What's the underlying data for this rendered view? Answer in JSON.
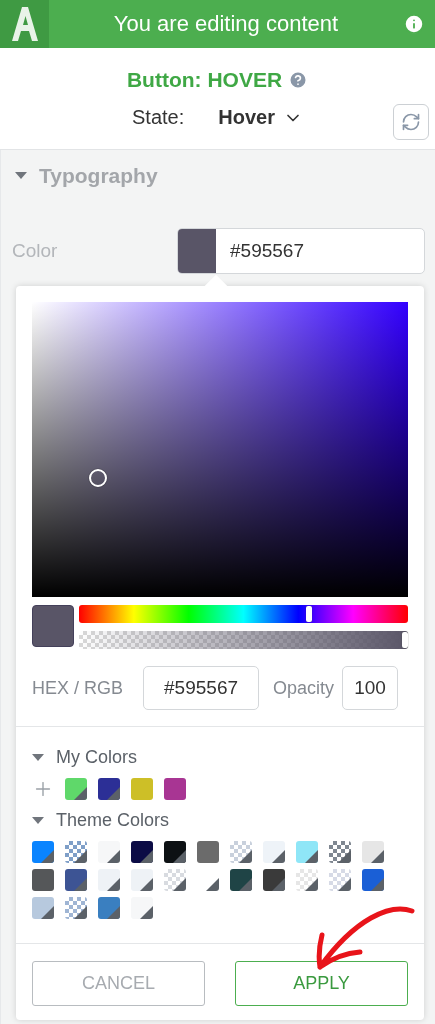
{
  "header": {
    "title": "You are editing content"
  },
  "panel_title": "Button: HOVER",
  "state": {
    "label": "State:",
    "value": "Hover"
  },
  "section": {
    "title": "Typography",
    "expanded": true
  },
  "color_field": {
    "label": "Color",
    "value": "#595567"
  },
  "picker": {
    "hue": {
      "level": 0.7
    },
    "alpha": {
      "level": 1
    },
    "hex_label": "HEX / RGB",
    "hex_value": "#595567",
    "opacity_label": "Opacity",
    "opacity_value": "100",
    "my_colors": {
      "title": "My Colors",
      "expanded": true,
      "swatches": [
        {
          "color": "#5fd86a",
          "kind": "solid",
          "corner": true
        },
        {
          "color": "#2c2f96",
          "kind": "solid",
          "corner": true
        },
        {
          "color": "#cdbf27",
          "kind": "solid",
          "corner": false
        },
        {
          "color": "#a83593",
          "kind": "solid",
          "corner": false
        }
      ]
    },
    "theme_colors": {
      "title": "Theme Colors",
      "expanded": true,
      "swatches": [
        {
          "color": "#0a84ff",
          "kind": "solid",
          "corner": true
        },
        {
          "color": "#7f9fc8",
          "kind": "checker",
          "corner": true
        },
        {
          "color": "#f6f7f8",
          "kind": "solid",
          "corner": true
        },
        {
          "color": "#0b0b45",
          "kind": "solid",
          "corner": true
        },
        {
          "color": "#0d1114",
          "kind": "solid",
          "corner": true
        },
        {
          "color": "#6b6b6b",
          "kind": "solid",
          "corner": false
        },
        {
          "color": "#c8d0dc",
          "kind": "checker",
          "corner": true
        },
        {
          "color": "#eef3f8",
          "kind": "solid",
          "corner": true
        },
        {
          "color": "#8fe6f7",
          "kind": "solid",
          "corner": true
        },
        {
          "color": "#7f8791",
          "kind": "checker",
          "corner": true
        },
        {
          "color": "#e6e6e6",
          "kind": "solid",
          "corner": true
        },
        {
          "color": "#555759",
          "kind": "solid",
          "corner": false
        },
        {
          "color": "#3d5494",
          "kind": "solid",
          "corner": true
        },
        {
          "color": "#eef2f6",
          "kind": "solid",
          "corner": true
        },
        {
          "color": "#eef2f6",
          "kind": "solid",
          "corner": true
        },
        {
          "color": "#d8dbe0",
          "kind": "checker",
          "corner": true
        },
        {
          "color": "#ffffff",
          "kind": "solid",
          "corner": true
        },
        {
          "color": "#1f4446",
          "kind": "solid",
          "corner": true
        },
        {
          "color": "#3a3a3a",
          "kind": "solid",
          "corner": true
        },
        {
          "color": "#e6e6e6",
          "kind": "checker",
          "corner": true
        },
        {
          "color": "#d6dae6",
          "kind": "checker",
          "corner": true
        },
        {
          "color": "#1a5fd6",
          "kind": "solid",
          "corner": true
        },
        {
          "color": "#b7c9de",
          "kind": "solid",
          "corner": true
        },
        {
          "color": "#9fb5d4",
          "kind": "checker",
          "corner": true
        },
        {
          "color": "#3a7fc0",
          "kind": "solid",
          "corner": true
        },
        {
          "color": "#f6f7f8",
          "kind": "solid",
          "corner": true
        }
      ]
    },
    "buttons": [
      {
        "label": "CANCEL",
        "kind": "cancel"
      },
      {
        "label": "APPLY",
        "kind": "apply"
      }
    ]
  }
}
